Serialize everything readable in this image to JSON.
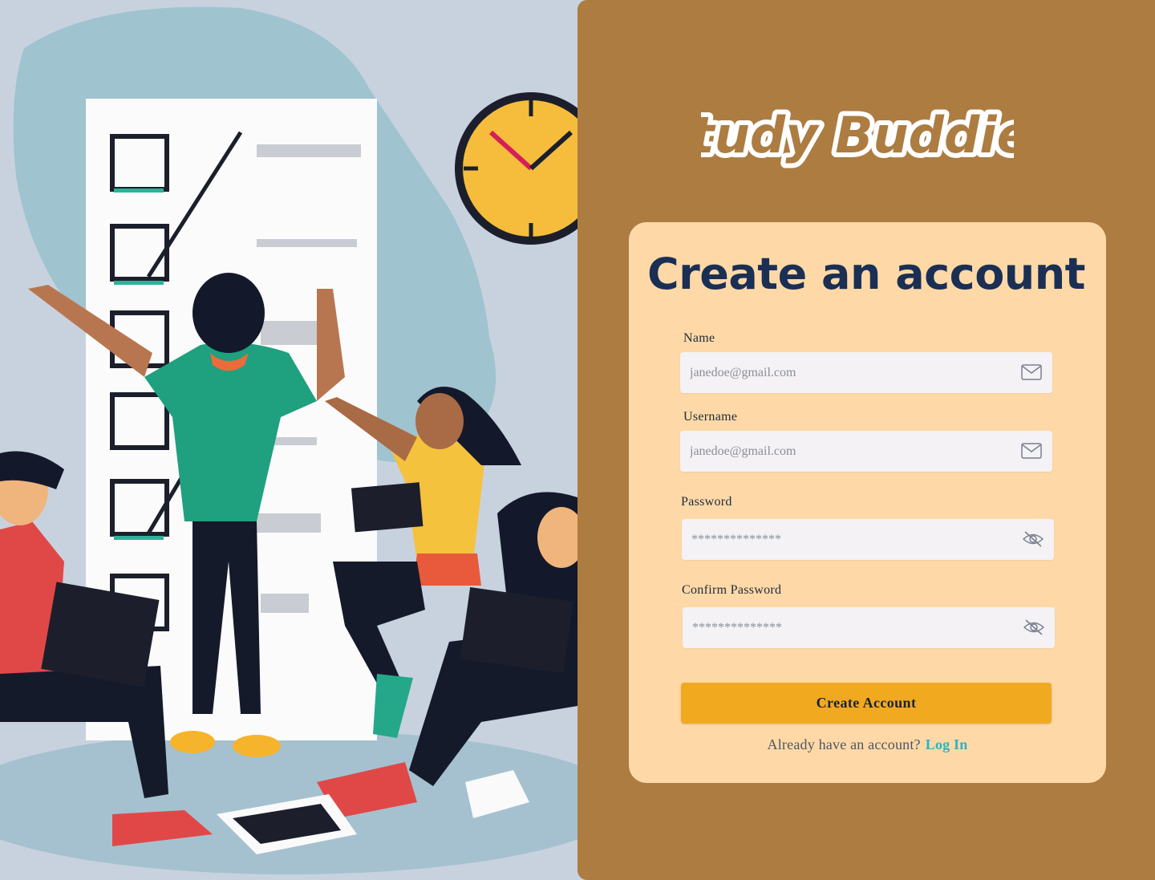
{
  "app": {
    "logo_text": "Study Buddies"
  },
  "form": {
    "title": "Create an account",
    "fields": [
      {
        "label": "Name",
        "placeholder": "janedoe@gmail.com",
        "icon": "mail-icon"
      },
      {
        "label": "Username",
        "placeholder": "janedoe@gmail.com",
        "icon": "mail-icon"
      },
      {
        "label": "Password",
        "placeholder": "**************",
        "icon": "eye-off-icon"
      },
      {
        "label": "Confirm Password",
        "placeholder": "**************",
        "icon": "eye-off-icon"
      }
    ],
    "submit_label": "Create Account",
    "login_prompt": "Already have an account?",
    "login_link": "Log In"
  },
  "colors": {
    "panel": "#ad7c41",
    "card": "#fed9a7",
    "heading": "#1b2f54",
    "button": "#f1a920",
    "link": "#2bb2c6",
    "input_bg": "#f4f2f4"
  }
}
